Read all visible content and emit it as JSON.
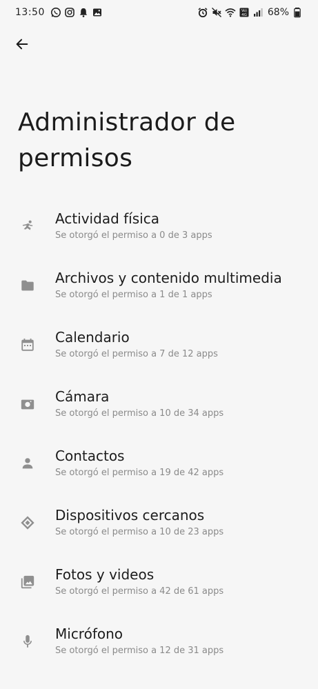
{
  "status_bar": {
    "time": "13:50",
    "battery": "68%",
    "network_label": "Vo) 4G"
  },
  "header": {
    "back_icon": "arrow-left-icon",
    "title": "Administrador de permisos"
  },
  "permissions": [
    {
      "icon": "physical-activity-icon",
      "name": "Actividad física",
      "desc": "Se otorgó el permiso a 0 de 3 apps"
    },
    {
      "icon": "folder-icon",
      "name": "Archivos y contenido multimedia",
      "desc": "Se otorgó el permiso a 1 de 1 apps"
    },
    {
      "icon": "calendar-icon",
      "name": "Calendario",
      "desc": "Se otorgó el permiso a 7 de 12 apps"
    },
    {
      "icon": "camera-icon",
      "name": "Cámara",
      "desc": "Se otorgó el permiso a 10 de 34 apps"
    },
    {
      "icon": "person-icon",
      "name": "Contactos",
      "desc": "Se otorgó el permiso a 19 de 42 apps"
    },
    {
      "icon": "nearby-devices-icon",
      "name": "Dispositivos cercanos",
      "desc": "Se otorgó el permiso a 10 de 23 apps"
    },
    {
      "icon": "photos-icon",
      "name": "Fotos y videos",
      "desc": "Se otorgó el permiso a 42 de 61 apps"
    },
    {
      "icon": "microphone-icon",
      "name": "Micrófono",
      "desc": "Se otorgó el permiso a 12 de 31 apps"
    }
  ],
  "colors": {
    "background": "#f6f6f6",
    "icon": "#8f8f8f",
    "secondary_text": "#8a8a8a"
  }
}
